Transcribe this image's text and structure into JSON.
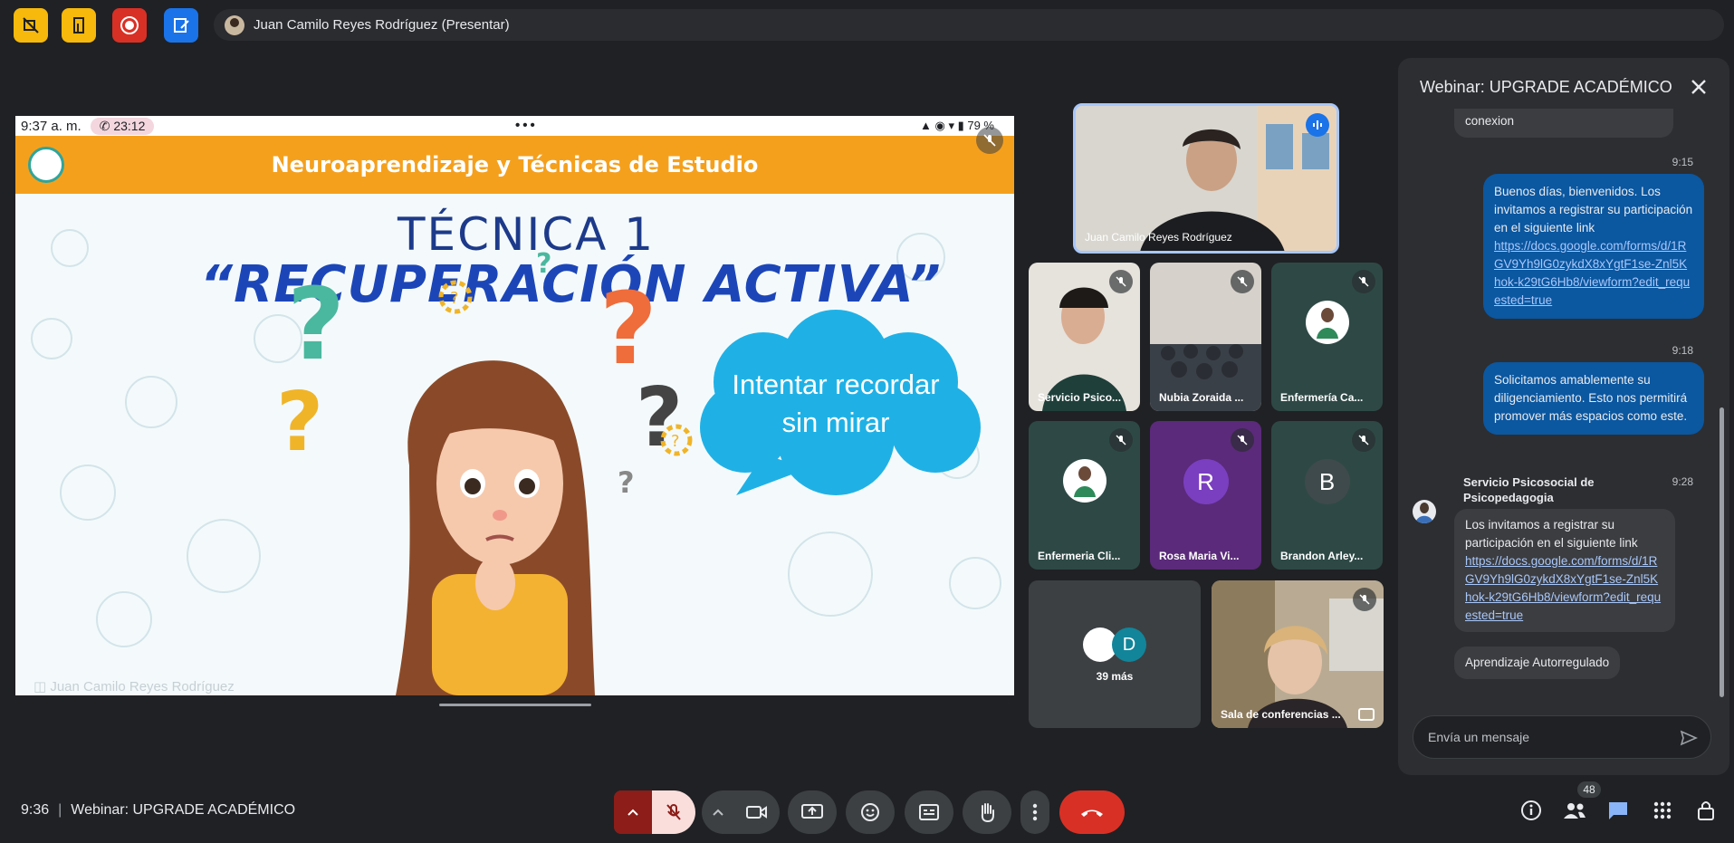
{
  "topbar": {
    "presenter_label": "Juan Camilo Reyes Rodríguez (Presentar)",
    "buttons": [
      {
        "icon": "no-video-icon",
        "color": "#f6b90c"
      },
      {
        "icon": "door-exit-icon",
        "color": "#f6b90c"
      },
      {
        "icon": "record-icon",
        "color": "#d93025"
      },
      {
        "icon": "edit-notes-icon",
        "color": "#1a73e8"
      }
    ]
  },
  "presentation": {
    "phone_time": "9:37 a. m.",
    "call_timer": "23:12",
    "battery": "79 %",
    "slide_header": "Neuroaprendizaje y Técnicas de Estudio",
    "title_line1": "TÉCNICA 1",
    "title_line2": "“RECUPERACIÓN ACTIVA”",
    "bubble_line1": "Intentar recordar",
    "bubble_line2": "sin mirar",
    "presenter_watermark": "Juan Camilo Reyes Rodríguez",
    "accent_color": "#f5a01d"
  },
  "tiles": {
    "featured": {
      "name": "Juan Camilo Reyes Rodríguez"
    },
    "grid": [
      {
        "name": "Servicio Psico...",
        "type": "video"
      },
      {
        "name": "Nubia Zoraida ...",
        "type": "video"
      },
      {
        "name": "Enfermería Ca...",
        "type": "avatar"
      },
      {
        "name": "Enfermeria Cli...",
        "type": "avatar"
      },
      {
        "name": "Rosa Maria Vi...",
        "type": "letter",
        "letter": "R",
        "color": "#6f2fb8"
      },
      {
        "name": "Brandon Arley...",
        "type": "letter",
        "letter": "B",
        "color": "#3c4a4c"
      }
    ],
    "more": {
      "label": "39 más",
      "letter": "D"
    },
    "conference": {
      "name": "Sala de conferencias ..."
    }
  },
  "chat": {
    "title": "Webinar: UPGRADE ACADÉMICO",
    "partial_text": "conexion",
    "messages": [
      {
        "time": "9:15",
        "text": "Buenos días, bienvenidos. Los invitamos a registrar su participación en el siguiente link",
        "link": "https://docs.google.com/forms/d/1RGV9Yh9lG0zykdX8xYgtF1se-Znl5Khok-k29tG6Hb8/viewform?edit_requested=true"
      },
      {
        "time": "9:18",
        "text": "Solicitamos amablemente su diligenciamiento. Esto nos permitirá promover más espacios como este."
      },
      {
        "time": "9:28",
        "sender": "Servicio Psicosocial de Psicopedagogia",
        "text": "Los invitamos a registrar su participación en el siguiente link",
        "link": "https://docs.google.com/forms/d/1RGV9Yh9lG0zykdX8xYgtF1se-Znl5Khok-k29tG6Hb8/viewform?edit_requested=true"
      },
      {
        "text": "Aprendizaje Autorregulado"
      }
    ],
    "input_placeholder": "Envía un mensaje"
  },
  "bottom": {
    "time": "9:36",
    "meeting_name": "Webinar: UPGRADE ACADÉMICO",
    "participants_count": "48",
    "end_call_color": "#d93025"
  }
}
